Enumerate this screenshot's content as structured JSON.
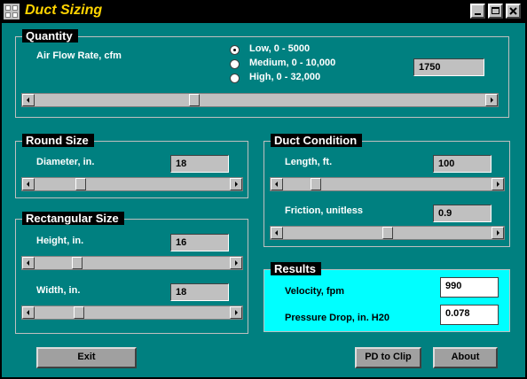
{
  "window": {
    "title": "Duct Sizing",
    "title_color": "#ffd400",
    "icons": {
      "app": "grid-app-icon",
      "minimize": "minimize-icon",
      "maximize": "maximize-icon",
      "close": "close-icon"
    }
  },
  "quantity": {
    "title": "Quantity",
    "label": "Air Flow Rate, cfm",
    "options": [
      "Low, 0 - 5000",
      "Medium, 0 - 10,000",
      "High, 0 - 32,000"
    ],
    "selected_option": "Low, 0 - 5000",
    "value": "1750",
    "slider_fraction": 0.35
  },
  "round_size": {
    "title": "Round Size",
    "diameter_label": "Diameter, in.",
    "diameter_value": "18",
    "slider_fraction": 0.22
  },
  "rectangular_size": {
    "title": "Rectangular Size",
    "height_label": "Height, in.",
    "height_value": "16",
    "width_label": "Width, in.",
    "width_value": "18",
    "height_fraction": 0.2,
    "width_fraction": 0.21
  },
  "duct_condition": {
    "title": "Duct Condition",
    "length_label": "Length, ft.",
    "length_value": "100",
    "friction_label": "Friction, unitless",
    "friction_value": "0.9",
    "length_fraction": 0.14,
    "friction_fraction": 0.5
  },
  "results": {
    "title": "Results",
    "velocity_label": "Velocity, fpm",
    "velocity_value": "990",
    "pressure_label": "Pressure Drop, in. H20",
    "pressure_value": "0.078",
    "background": "#00ffff"
  },
  "buttons": {
    "exit": "Exit",
    "pd_to_clip": "PD to Clip",
    "about": "About"
  },
  "colors": {
    "client_bg": "#008080",
    "title_bg": "#000000",
    "control_gray": "#c0c0c0"
  }
}
